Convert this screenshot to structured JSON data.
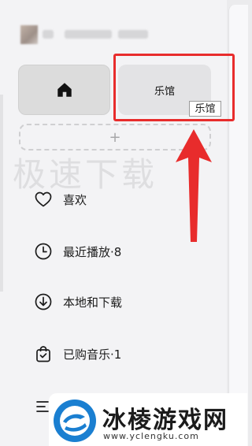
{
  "tiles": {
    "home_icon": "home-icon",
    "library_label": "乐馆",
    "tooltip": "乐馆",
    "add_symbol": "+"
  },
  "watermark": "极速下载",
  "nav": [
    {
      "icon": "heart-icon",
      "label": "喜欢"
    },
    {
      "icon": "clock-icon",
      "label": "最近播放·8"
    },
    {
      "icon": "download-icon",
      "label": "本地和下载"
    },
    {
      "icon": "shopping-bag-icon",
      "label": "已购音乐·1"
    }
  ],
  "brand": {
    "title": "冰棱游戏网",
    "url": "www.yclengku.com"
  },
  "colors": {
    "highlight": "#e82c2c",
    "arrow": "#e82c2c",
    "brand_blue": "#1a7fd1"
  }
}
